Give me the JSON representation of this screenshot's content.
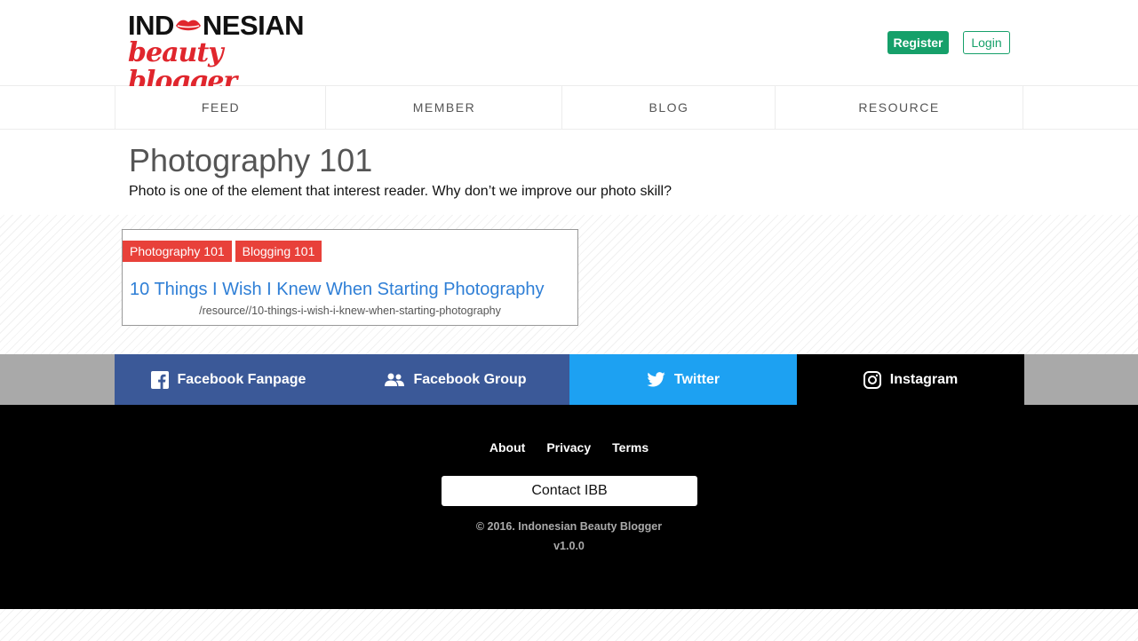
{
  "header": {
    "logo_top_left": "IND",
    "logo_top_right": "NESIAN",
    "logo_bottom": "beauty blogger",
    "register_label": "Register",
    "login_label": "Login"
  },
  "nav": {
    "items": [
      {
        "label": "FEED"
      },
      {
        "label": "MEMBER"
      },
      {
        "label": "BLOG"
      },
      {
        "label": "RESOURCE"
      }
    ]
  },
  "page": {
    "title": "Photography 101",
    "description": "Photo is one of the element that interest reader. Why don’t we improve our photo skill?"
  },
  "card": {
    "tags": [
      "Photography 101",
      "Blogging 101"
    ],
    "link_text": "10 Things I Wish I Knew When Starting Photography",
    "path": "/resource//10-things-i-wish-i-knew-when-starting-photography"
  },
  "social": {
    "facebook_fanpage": "Facebook Fanpage",
    "facebook_group": "Facebook Group",
    "twitter": "Twitter",
    "instagram": "Instagram",
    "colors": {
      "facebook": "#3b5998",
      "twitter": "#1da1f2",
      "instagram": "#000000",
      "bar": "#a9a9a9"
    }
  },
  "footer": {
    "links": [
      "About",
      "Privacy",
      "Terms"
    ],
    "contact_label": "Contact IBB",
    "copyright": "© 2016. Indonesian Beauty Blogger",
    "version": "v1.0.0"
  },
  "colors": {
    "accent_green": "#16a06a",
    "tag_red": "#e8413a",
    "link_blue": "#2f7fd6",
    "logo_red": "#e0262d"
  },
  "icons": [
    "lips-logo-icon",
    "facebook-icon",
    "group-icon",
    "twitter-icon",
    "instagram-icon"
  ]
}
